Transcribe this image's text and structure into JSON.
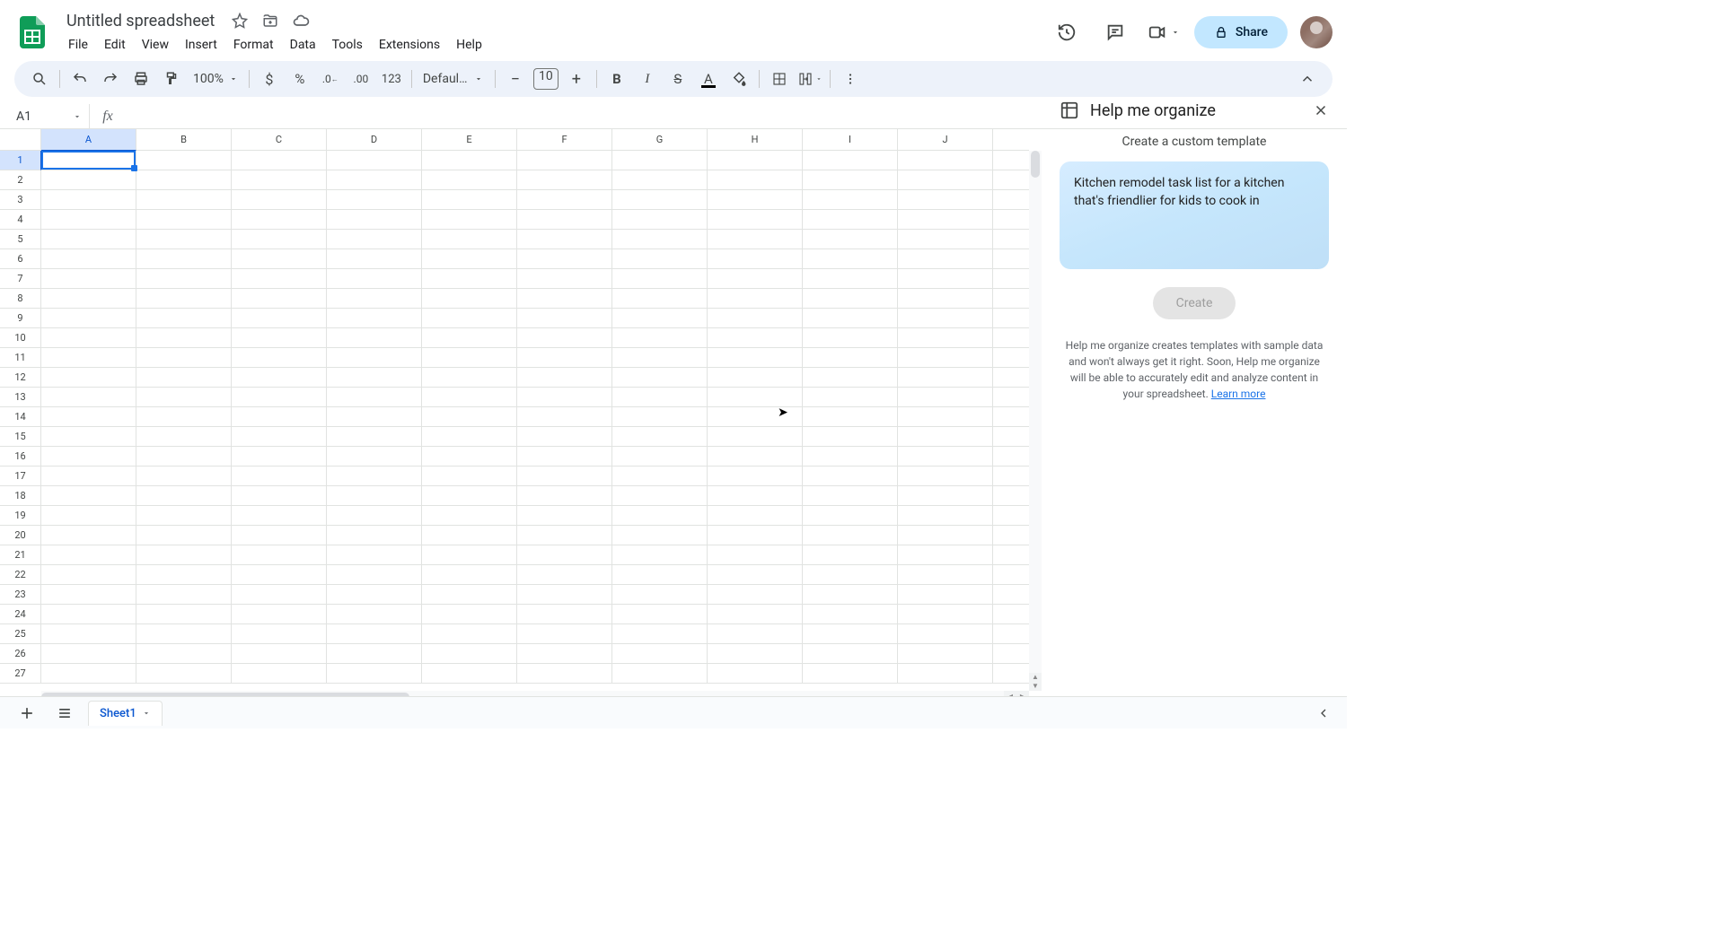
{
  "doc": {
    "title": "Untitled spreadsheet"
  },
  "menubar": {
    "items": [
      "File",
      "Edit",
      "View",
      "Insert",
      "Format",
      "Data",
      "Tools",
      "Extensions",
      "Help"
    ]
  },
  "header_right": {
    "share": "Share"
  },
  "toolbar": {
    "zoom": "100%",
    "font": "Defaul…",
    "font_size": "10",
    "number_format": "123"
  },
  "name_box": {
    "value": "A1"
  },
  "columns": [
    "A",
    "B",
    "C",
    "D",
    "E",
    "F",
    "G",
    "H",
    "I",
    "J"
  ],
  "rows": [
    "1",
    "2",
    "3",
    "4",
    "5",
    "6",
    "7",
    "8",
    "9",
    "10",
    "11",
    "12",
    "13",
    "14",
    "15",
    "16",
    "17",
    "18",
    "19",
    "20",
    "21",
    "22",
    "23",
    "24",
    "25",
    "26",
    "27"
  ],
  "selected": {
    "col": 0,
    "row": 0
  },
  "sidebar": {
    "title": "Help me organize",
    "subtitle": "Create a custom template",
    "prompt": "Kitchen remodel task list for a kitchen that's friendlier for kids to cook in",
    "create": "Create",
    "disclaimer_pre": "Help me organize creates templates with sample data and won't always get it right. Soon, Help me organize will be able to accurately edit and analyze content in your spreadsheet. ",
    "learn_more": "Learn more"
  },
  "sheet_bar": {
    "tab": "Sheet1"
  }
}
